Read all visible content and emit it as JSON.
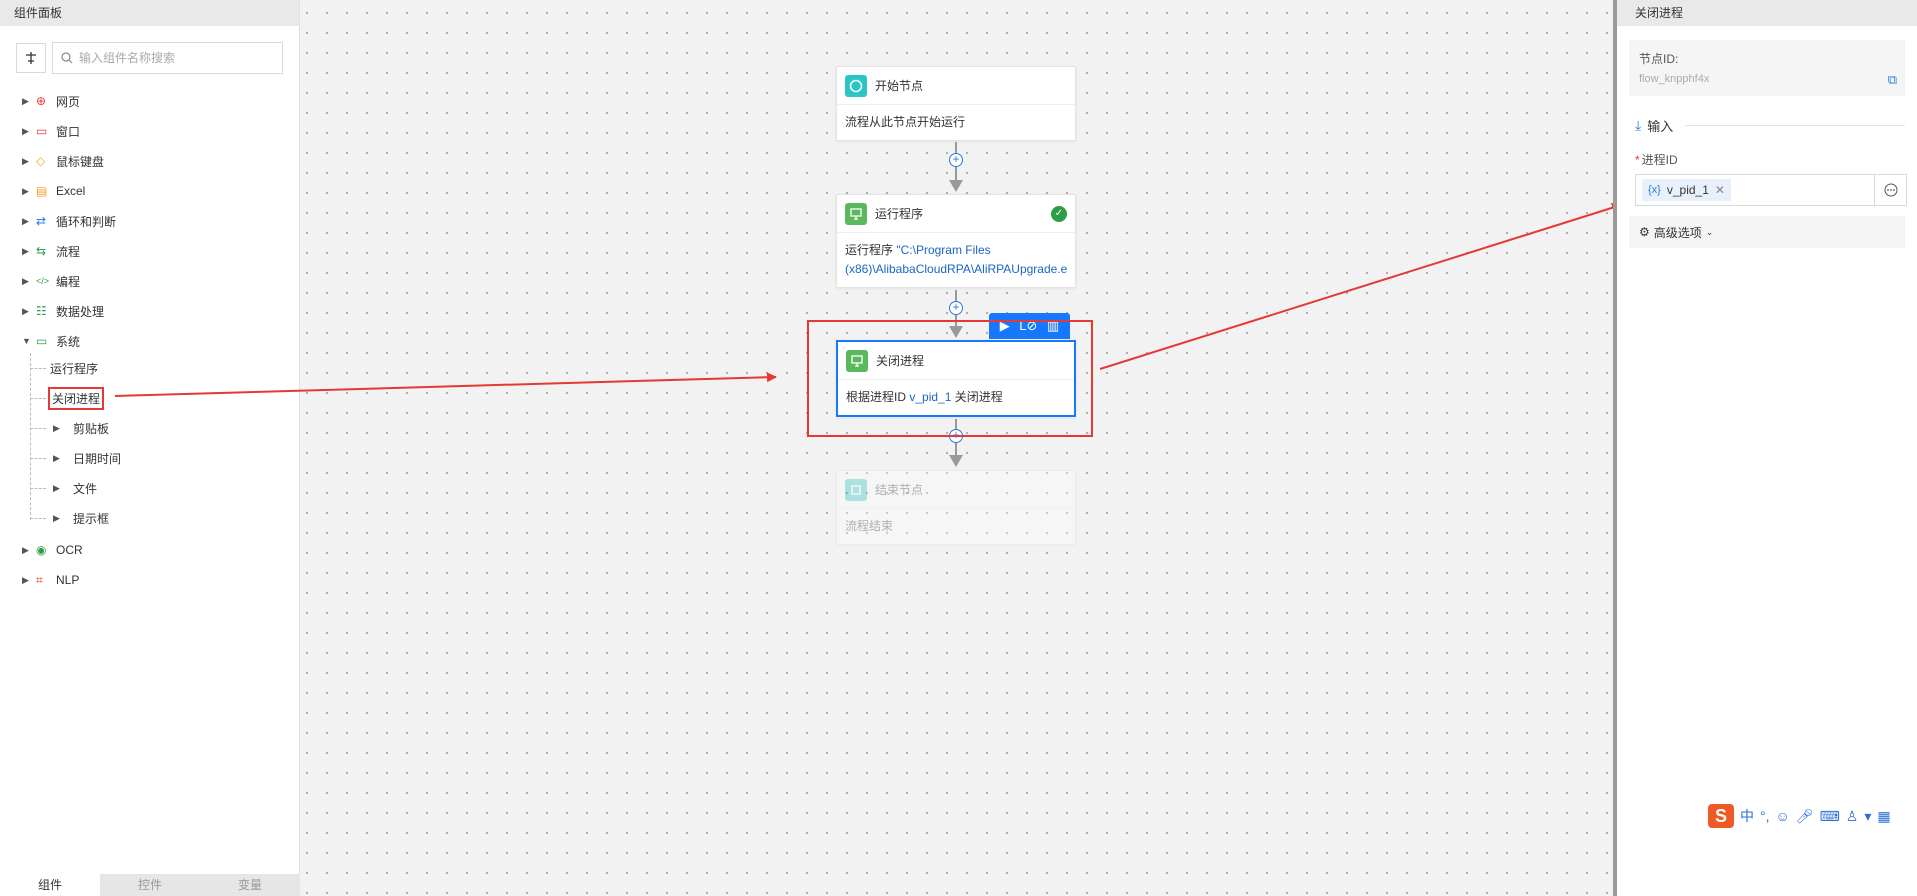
{
  "left_panel": {
    "title": "组件面板",
    "search_placeholder": "输入组件名称搜索",
    "categories": [
      {
        "label": "网页",
        "icon": "globe-icon",
        "color": "#e53935",
        "glyph": "⊕"
      },
      {
        "label": "窗口",
        "icon": "window-icon",
        "color": "#e53935",
        "glyph": "▭"
      },
      {
        "label": "鼠标键盘",
        "icon": "mouse-keyboard-icon",
        "color": "#f5a623",
        "glyph": "◇"
      },
      {
        "label": "Excel",
        "icon": "excel-icon",
        "color": "#f5a623",
        "glyph": "▤"
      },
      {
        "label": "循环和判断",
        "icon": "loop-icon",
        "color": "#2a7de1",
        "glyph": "⇄"
      },
      {
        "label": "流程",
        "icon": "flow-icon",
        "color": "#2e9d48",
        "glyph": "⇆"
      },
      {
        "label": "编程",
        "icon": "code-icon",
        "color": "#2e9d48",
        "glyph": "‹/›"
      },
      {
        "label": "数据处理",
        "icon": "data-icon",
        "color": "#2e9d48",
        "glyph": "☷"
      },
      {
        "label": "系统",
        "icon": "monitor-icon",
        "color": "#2e9d48",
        "glyph": "▭"
      }
    ],
    "system_children": [
      {
        "label": "运行程序"
      },
      {
        "label": "关闭进程"
      }
    ],
    "system_folders": [
      {
        "label": "剪贴板"
      },
      {
        "label": "日期时间"
      },
      {
        "label": "文件"
      },
      {
        "label": "提示框"
      }
    ],
    "tail_categories": [
      {
        "label": "OCR",
        "icon": "eye-icon",
        "color": "#2e9d48",
        "glyph": "◉"
      },
      {
        "label": "NLP",
        "icon": "nlp-icon",
        "color": "#e53935",
        "glyph": "⌗"
      }
    ],
    "bottom_tabs": [
      "组件",
      "控件",
      "变量"
    ]
  },
  "canvas": {
    "nodes": {
      "start": {
        "title": "开始节点",
        "body": "流程从此节点开始运行"
      },
      "run": {
        "title": "运行程序",
        "body_prefix": "运行程序 ",
        "body_path1": "\"C:\\Program Files",
        "body_path2": "(x86)\\AlibabaCloudRPA\\AliRPAUpgrade.e"
      },
      "close": {
        "title": "关闭进程",
        "body_prefix": "根据进程ID ",
        "body_var": "v_pid_1",
        "body_suffix": " 关闭进程"
      },
      "end": {
        "title": "结束节点",
        "body": "流程结束"
      }
    }
  },
  "right_panel": {
    "title": "关闭进程",
    "node_id_label": "节点ID:",
    "node_id_value": "flow_knpphf4x",
    "section_input": "输入",
    "field_label": "进程ID",
    "var_tag_prefix": "{x}",
    "var_tag": "v_pid_1",
    "advanced": "高级选项"
  },
  "ime": {
    "lang": "中",
    "punct": "°,"
  }
}
